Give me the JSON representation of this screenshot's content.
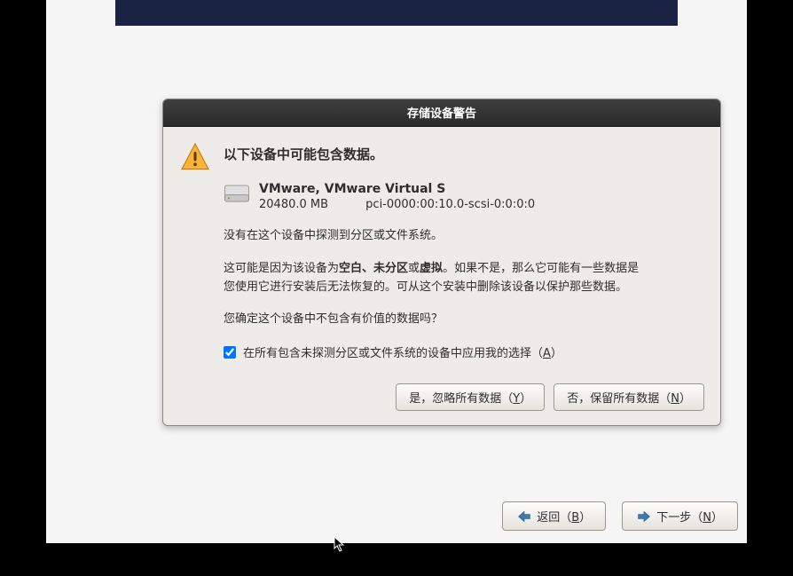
{
  "dialog": {
    "title": "存储设备警告",
    "heading": "以下设备中可能包含数据。",
    "device": {
      "name": "VMware, VMware Virtual S",
      "size": "20480.0 MB",
      "path": "pci-0000:00:10.0-scsi-0:0:0:0"
    },
    "para1": "没有在这个设备中探测到分区或文件系统。",
    "para2_a": "这可能是因为该设备为",
    "para2_bold": "空白、未分区",
    "para2_b": "或",
    "para2_bold2": "虚拟",
    "para2_c": "。如果不是，那么它可能有一些数据是您使用它进行安装后无法恢复的。可从这个安装中删除该设备以保护那些数据。",
    "para3": "您确定这个设备中不包含有价值的数据吗？",
    "checkbox_label_a": "在所有包含未探测分区或文件系统的设备中应用我的选择（",
    "checkbox_mn": "A",
    "checkbox_label_b": "）",
    "btn_yes_a": "是，忽略所有数据（",
    "btn_yes_mn": "Y",
    "btn_yes_b": "）",
    "btn_no_a": "否，保留所有数据（",
    "btn_no_mn": "N",
    "btn_no_b": "）"
  },
  "nav": {
    "back_a": "返回（",
    "back_mn": "B",
    "back_b": "）",
    "next_a": "下一步（",
    "next_mn": "N",
    "next_b": "）"
  }
}
